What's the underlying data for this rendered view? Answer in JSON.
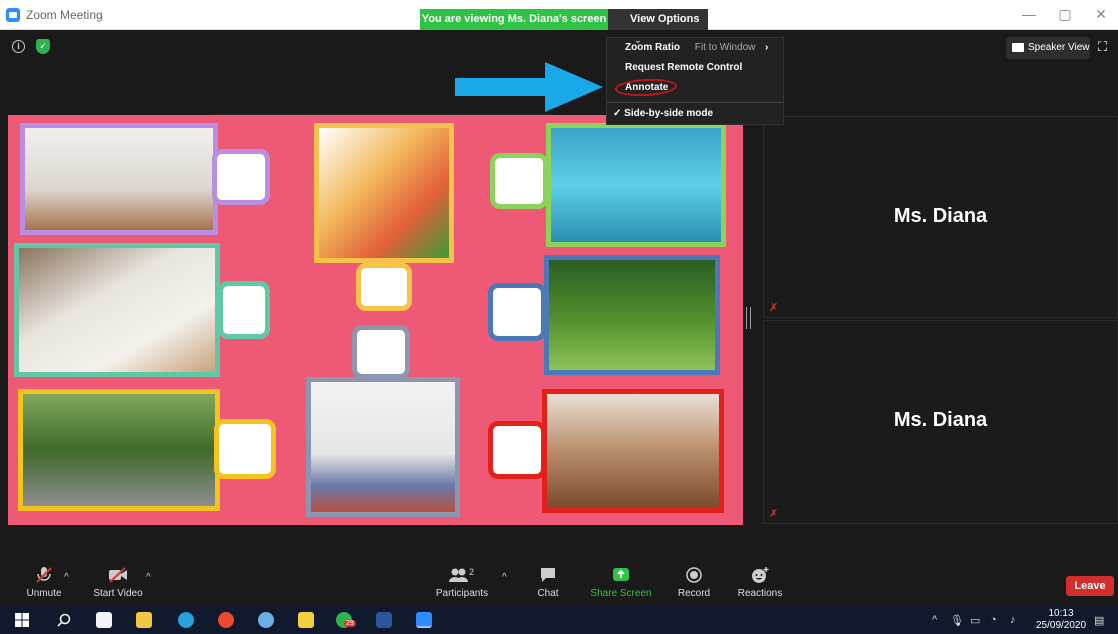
{
  "window": {
    "title": "Zoom Meeting",
    "minimize": "—",
    "restore": "▢",
    "close": "✕"
  },
  "banner": {
    "viewing_text": "You are viewing Ms. Diana's screen",
    "view_options": "View Options",
    "view_options_chevron": "⌄"
  },
  "menu": {
    "zoom_ratio": "Zoom Ratio",
    "zoom_ratio_value": "Fit to Window",
    "request_remote": "Request Remote Control",
    "annotate": "Annotate",
    "side_by_side": "✓ Side-by-side mode"
  },
  "header": {
    "info_icon": "i",
    "speaker_view": "Speaker View",
    "fullscreen_icon": "⛶"
  },
  "participants": [
    {
      "name": "Ms. Diana"
    },
    {
      "name": "Ms. Diana"
    }
  ],
  "toolbar": {
    "unmute": "Unmute",
    "start_video": "Start Video",
    "participants": "Participants",
    "participants_count": "2",
    "chat": "Chat",
    "share_screen": "Share Screen",
    "record": "Record",
    "reactions": "Reactions",
    "leave": "Leave"
  },
  "taskbar": {
    "time": "10:13",
    "date": "25/09/2020",
    "whatsapp_badge": "29"
  },
  "colors": {
    "banner_green": "#30c245",
    "slide_pink": "#ee5a76",
    "share_green": "#30c245",
    "leave_red": "#d22e2e",
    "arrow_blue": "#1aa9e8",
    "annot_circle": "#c2141a"
  }
}
